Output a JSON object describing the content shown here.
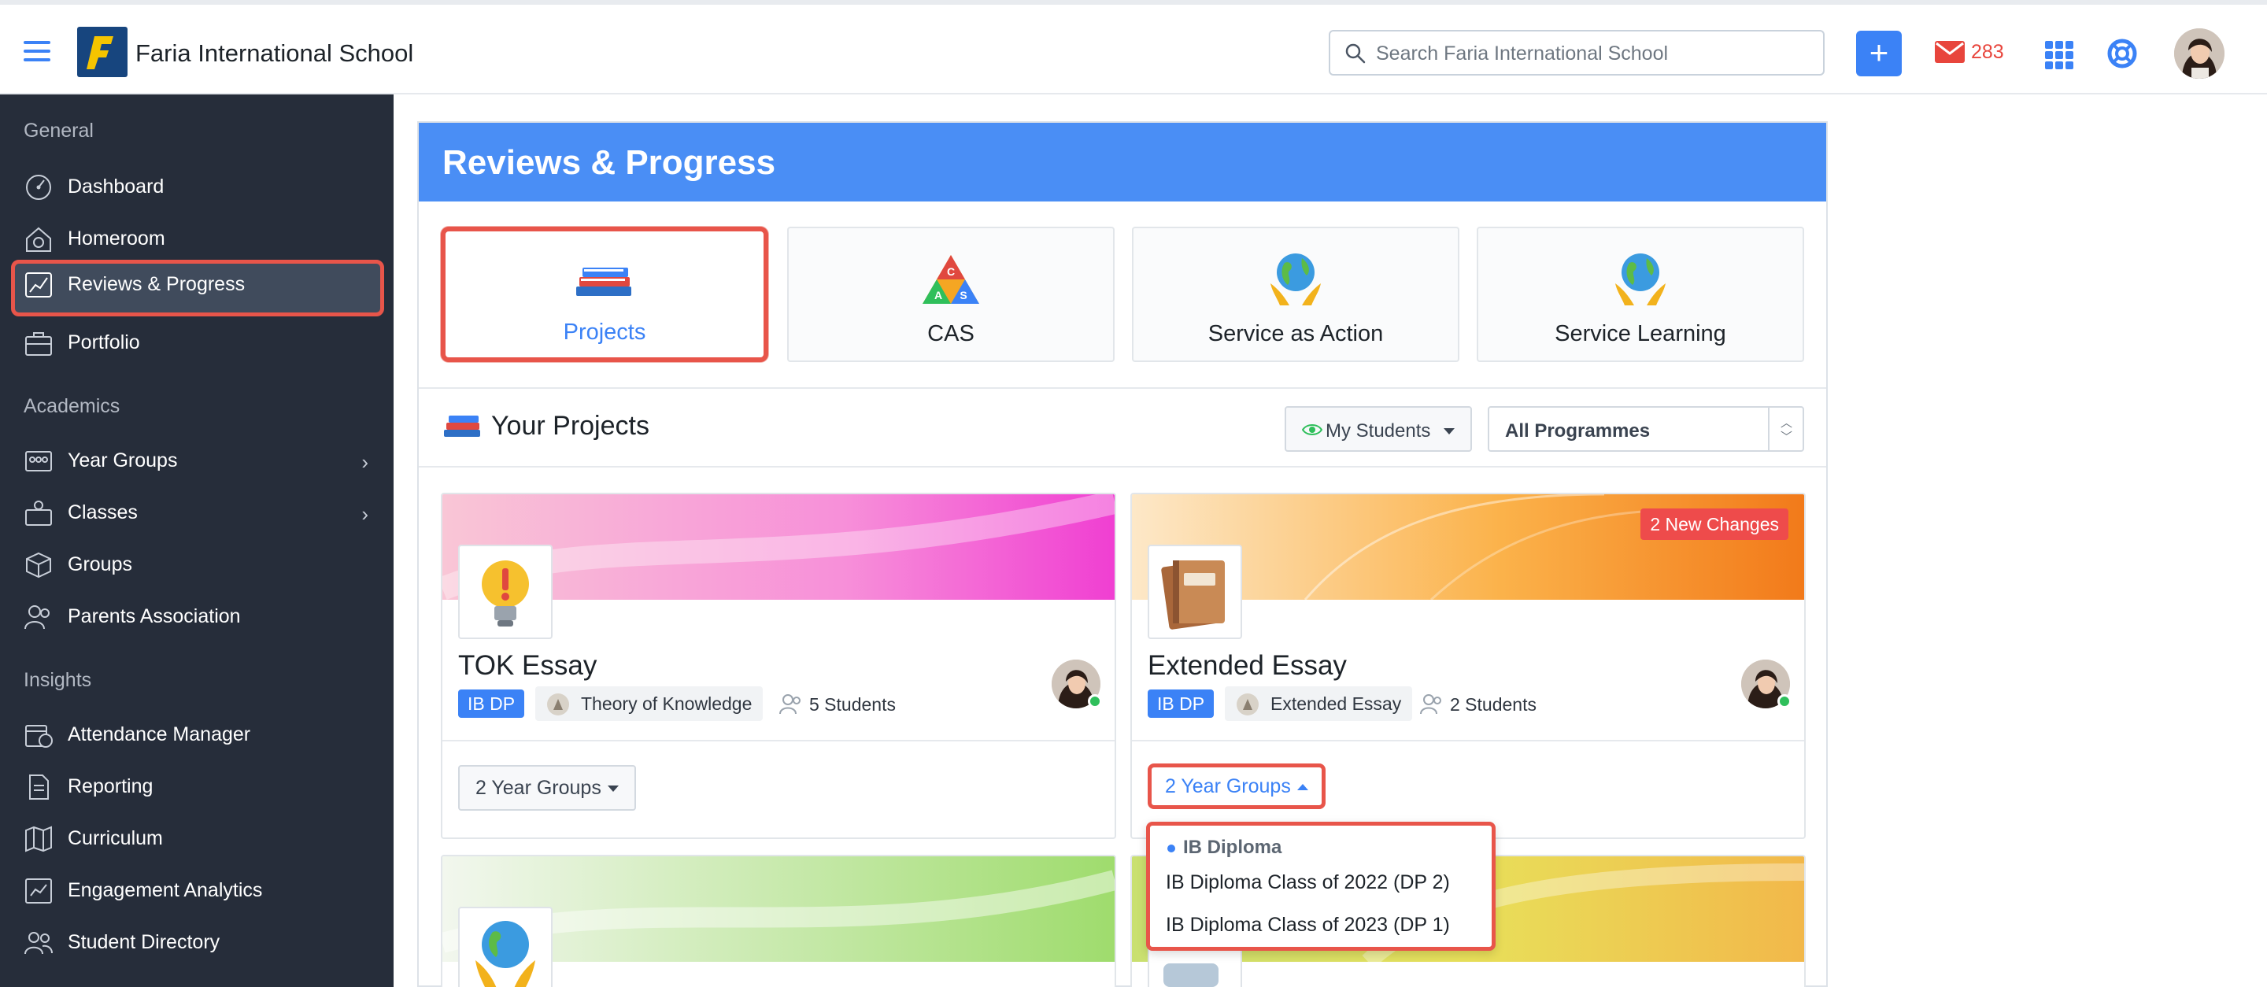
{
  "header": {
    "school_name": "Faria International School",
    "search_placeholder": "Search Faria International School",
    "add_label": "+",
    "mail_count": "283"
  },
  "sidebar": {
    "sections": [
      {
        "title": "General"
      },
      {
        "title": "Academics"
      },
      {
        "title": "Insights"
      }
    ],
    "items": [
      {
        "label": "Dashboard",
        "icon": "dashboard-icon"
      },
      {
        "label": "Homeroom",
        "icon": "homeroom-icon"
      },
      {
        "label": "Reviews & Progress",
        "icon": "chart-line-icon",
        "active": true
      },
      {
        "label": "Portfolio",
        "icon": "briefcase-icon"
      },
      {
        "label": "Year Groups",
        "icon": "year-groups-icon",
        "has_children": true
      },
      {
        "label": "Classes",
        "icon": "classes-icon",
        "has_children": true
      },
      {
        "label": "Groups",
        "icon": "cube-icon"
      },
      {
        "label": "Parents Association",
        "icon": "users-icon"
      },
      {
        "label": "Attendance Manager",
        "icon": "calendar-clock-icon"
      },
      {
        "label": "Reporting",
        "icon": "document-icon"
      },
      {
        "label": "Curriculum",
        "icon": "map-icon"
      },
      {
        "label": "Engagement Analytics",
        "icon": "analytics-icon"
      },
      {
        "label": "Student Directory",
        "icon": "directory-icon"
      }
    ]
  },
  "main": {
    "title": "Reviews & Progress",
    "tiles": [
      {
        "label": "Projects",
        "icon": "books-icon",
        "selected": true
      },
      {
        "label": "CAS",
        "icon": "cas-triangle-icon"
      },
      {
        "label": "Service as Action",
        "icon": "globe-hands-icon"
      },
      {
        "label": "Service Learning",
        "icon": "globe-hands-icon"
      }
    ],
    "your_projects_title": "Your Projects",
    "filter_students": "My Students",
    "filter_programme": "All Programmes",
    "projects": [
      {
        "name": "TOK Essay",
        "programme": "IB DP",
        "subject": "Theory of Knowledge",
        "students": "5 Students",
        "year_groups": "2 Year Groups",
        "icon": "lightbulb-icon",
        "accent": "#f33fd0"
      },
      {
        "name": "Extended Essay",
        "programme": "IB DP",
        "subject": "Extended Essay",
        "students": "2 Students",
        "year_groups": "2 Year Groups",
        "badge": "2 New Changes",
        "icon": "notebook-icon",
        "accent": "#f27a1a"
      }
    ],
    "dropdown": {
      "header": "IB Diploma",
      "options": [
        "IB Diploma Class of 2022 (DP 2)",
        "IB Diploma Class of 2023 (DP 1)"
      ]
    }
  },
  "colors": {
    "primary": "#3b82f6",
    "sidebar_bg": "#262d3a",
    "highlight": "#e8554a",
    "header_band": "#4a8ef5"
  }
}
